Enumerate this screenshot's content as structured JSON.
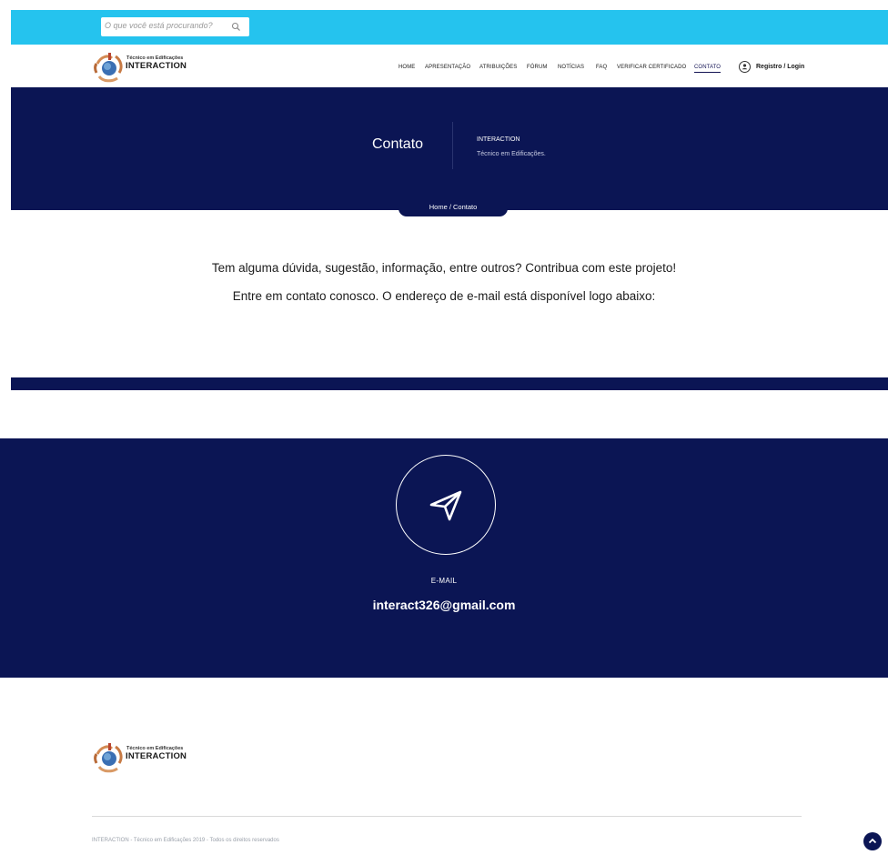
{
  "search": {
    "placeholder": "O que você está procurando?",
    "icon": "search-icon"
  },
  "brand": {
    "tagline": "Técnico em Edificações",
    "name": "INTERACTION"
  },
  "nav": {
    "items": [
      {
        "label": "HOME"
      },
      {
        "label": "APRESENTAÇÃO"
      },
      {
        "label": "ATRIBUIÇÕES"
      },
      {
        "label": "FÓRUM"
      },
      {
        "label": "NOTÍCIAS"
      },
      {
        "label": "FAQ"
      },
      {
        "label": "VERIFICAR CERTIFICADO"
      },
      {
        "label": "CONTATO",
        "active": true
      }
    ],
    "login_label": "Registro / Login"
  },
  "hero": {
    "title": "Contato",
    "org": "INTERACTION",
    "course": "Técnico em Edificações.",
    "breadcrumb": "Home / Contato"
  },
  "intro": {
    "line1": "Tem alguma dúvida, sugestão, informação, entre outros? Contribua com este projeto!",
    "line2": "Entre em contato conosco. O endereço de e-mail está disponível logo abaixo:"
  },
  "contact": {
    "label": "E-MAIL",
    "email": "interact326@gmail.com",
    "icon": "paper-plane-icon"
  },
  "footer": {
    "copyright": "INTERACTION - Técnico em Edificações 2019 - Todos os direitos reservados"
  },
  "colors": {
    "primary": "#0b1554",
    "topbar": "#25c3ee"
  }
}
